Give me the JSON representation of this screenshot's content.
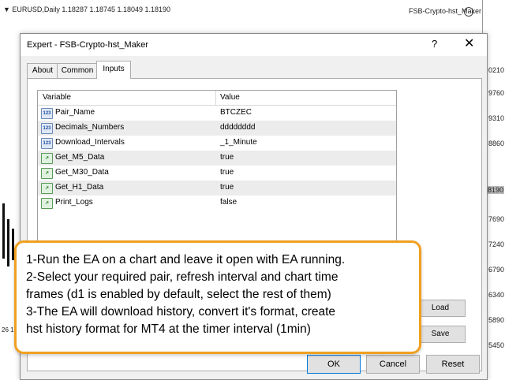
{
  "chart": {
    "symbol_info": "▼ EURUSD,Daily  1.18287 1.18745 1.18049 1.18190",
    "ea_name": "FSB-Crypto-hst_Maker",
    "price_labels": [
      {
        "text": "0210",
        "highlight": false
      },
      {
        "text": "9760",
        "highlight": false
      },
      {
        "text": "9310",
        "highlight": false
      },
      {
        "text": "8860",
        "highlight": false
      },
      {
        "text": "8190",
        "highlight": true
      },
      {
        "text": "7690",
        "highlight": false
      },
      {
        "text": "7240",
        "highlight": false
      },
      {
        "text": "6790",
        "highlight": false
      },
      {
        "text": "6340",
        "highlight": false
      },
      {
        "text": "5890",
        "highlight": false
      },
      {
        "text": "5450",
        "highlight": false
      }
    ],
    "left_label": "26 1"
  },
  "dialog": {
    "title": "Expert - FSB-Crypto-hst_Maker",
    "help_label": "?",
    "close_label": "✕",
    "tabs": [
      {
        "label": "About",
        "active": false
      },
      {
        "label": "Common",
        "active": false
      },
      {
        "label": "Inputs",
        "active": true
      }
    ],
    "grid": {
      "headers": {
        "variable": "Variable",
        "value": "Value"
      },
      "rows": [
        {
          "name": "Pair_Name",
          "value": "BTCZEC",
          "icon": "123",
          "type": "number"
        },
        {
          "name": "Decimals_Numbers",
          "value": "dddddddd",
          "icon": "123",
          "type": "number"
        },
        {
          "name": "Download_Intervals",
          "value": "_1_Minute",
          "icon": "123",
          "type": "number"
        },
        {
          "name": "Get_M5_Data",
          "value": "true",
          "icon": "↗",
          "type": "bool"
        },
        {
          "name": "Get_M30_Data",
          "value": "true",
          "icon": "↗",
          "type": "bool"
        },
        {
          "name": "Get_H1_Data",
          "value": "true",
          "icon": "↗",
          "type": "bool"
        },
        {
          "name": "Print_Logs",
          "value": "false",
          "icon": "↗",
          "type": "bool"
        }
      ]
    },
    "side_buttons": {
      "load": "Load",
      "save": "Save"
    },
    "buttons": {
      "ok": "OK",
      "cancel": "Cancel",
      "reset": "Reset"
    }
  },
  "callout": {
    "lines": [
      "1-Run the EA on a chart and leave it open with EA running.",
      "2-Select your required pair, refresh interval and chart time",
      "frames (d1 is enabled by default, select the rest of them)",
      "3-The EA will download history, convert it's format, create",
      "hst history format for MT4 at the timer interval (1min)"
    ],
    "border_color": "#f0a020"
  }
}
